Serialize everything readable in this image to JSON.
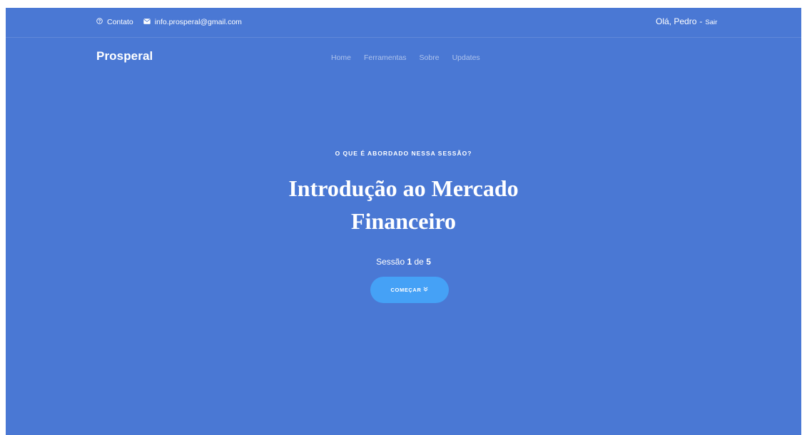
{
  "topbar": {
    "contact_icon": "question-circle-icon",
    "contact_label": "Contato",
    "email_icon": "envelope-icon",
    "email": "info.prosperal@gmail.com",
    "greeting": "Olá, Pedro",
    "separator": "-",
    "logout_label": "Sair"
  },
  "nav": {
    "brand": "Prosperal",
    "items": [
      {
        "label": "Home"
      },
      {
        "label": "Ferramentas"
      },
      {
        "label": "Sobre"
      },
      {
        "label": "Updates"
      }
    ]
  },
  "hero": {
    "eyebrow": "O QUE É ABORDADO NESSA SESSÃO?",
    "title_line1": "Introdução ao Mercado",
    "title_line2": "Financeiro",
    "session_prefix": "Sessão",
    "session_current": "1",
    "session_of": "de",
    "session_total": "5",
    "cta_label": "COMEÇAR",
    "cta_icon": "double-chevron-down-icon"
  },
  "colors": {
    "background": "#4a78d4",
    "cta": "#45a1f6",
    "text": "#ffffff"
  }
}
